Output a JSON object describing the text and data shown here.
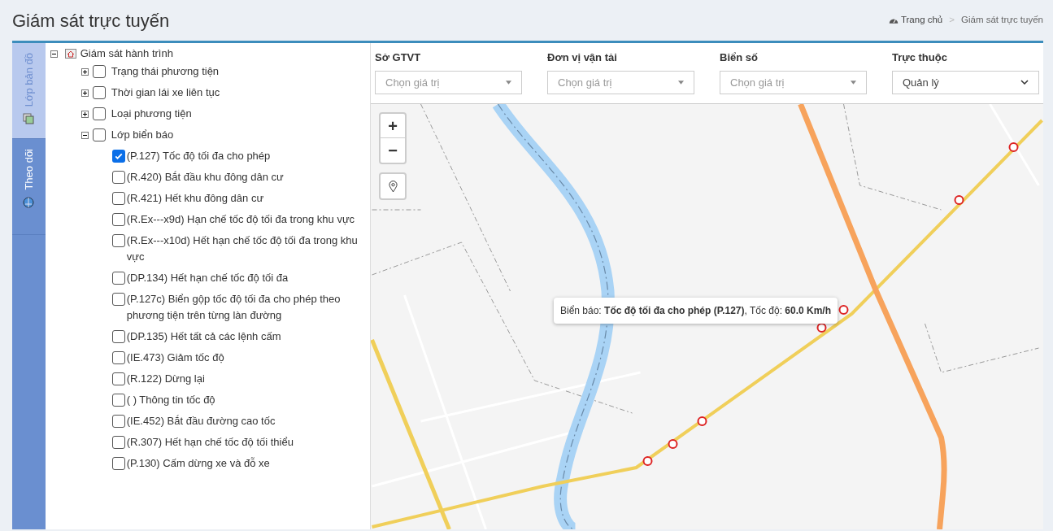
{
  "page_title": "Giám sát trực tuyến",
  "breadcrumb_separator": ">",
  "breadcrumb": [
    {
      "label": "Trang chủ",
      "kind": "home"
    },
    {
      "label": "Giám sát trực tuyến",
      "kind": "current"
    }
  ],
  "side_tabs": [
    {
      "label": "Lớp bản đồ",
      "selected": true
    },
    {
      "label": "Theo dõi",
      "selected": false
    }
  ],
  "tree": {
    "label": "Giám sát hành trình",
    "expanded": true,
    "children": [
      {
        "label": "Trạng thái phương tiện",
        "expanded": false,
        "checked": false
      },
      {
        "label": "Thời gian lái xe liên tục",
        "expanded": false,
        "checked": false
      },
      {
        "label": "Loại phương tiện",
        "expanded": false,
        "checked": false
      },
      {
        "label": "Lớp biển báo",
        "expanded": true,
        "checked": false,
        "children": [
          {
            "label": "(P.127) Tốc độ tối đa cho phép",
            "checked": true
          },
          {
            "label": "(R.420) Bắt đầu khu đông dân cư",
            "checked": false
          },
          {
            "label": "(R.421) Hết khu đông dân cư",
            "checked": false
          },
          {
            "label": "(R.Ex---x9d) Hạn chế tốc độ tối đa trong khu vực",
            "checked": false
          },
          {
            "label": "(R.Ex---x10d) Hết hạn chế tốc độ tối đa trong khu vực",
            "checked": false
          },
          {
            "label": "(DP.134) Hết hạn chế tốc độ tối đa",
            "checked": false
          },
          {
            "label": "(P.127c) Biển gộp tốc độ tối đa cho phép theo phương tiện trên từng làn đường",
            "checked": false
          },
          {
            "label": "(DP.135) Hết tất cả các lệnh cấm",
            "checked": false
          },
          {
            "label": "(IE.473) Giảm tốc độ",
            "checked": false
          },
          {
            "label": "(R.122) Dừng lại",
            "checked": false
          },
          {
            "label": "( ) Thông tin tốc độ",
            "checked": false
          },
          {
            "label": "(IE.452) Bắt đầu đường cao tốc",
            "checked": false
          },
          {
            "label": "(R.307) Hết hạn chế tốc độ tối thiểu",
            "checked": false
          },
          {
            "label": "(P.130) Cấm dừng xe và đỗ xe",
            "checked": false
          }
        ]
      }
    ]
  },
  "filters": [
    {
      "label": "Sở GTVT",
      "kind": "combo",
      "placeholder": "Chọn giá trị"
    },
    {
      "label": "Đơn vị vận tải",
      "kind": "combo",
      "placeholder": "Chọn giá trị"
    },
    {
      "label": "Biển số",
      "kind": "combo",
      "placeholder": "Chọn giá trị"
    },
    {
      "label": "Trực thuộc",
      "kind": "select",
      "value": "Quản lý"
    }
  ],
  "map": {
    "zoom_in": "+",
    "zoom_out": "−",
    "popup": {
      "prefix": "Biển báo: ",
      "sign": "Tốc độ tối đa cho phép (P.127)",
      "speed_label": ", Tốc độ: ",
      "speed": "60.0 Km/h"
    }
  }
}
